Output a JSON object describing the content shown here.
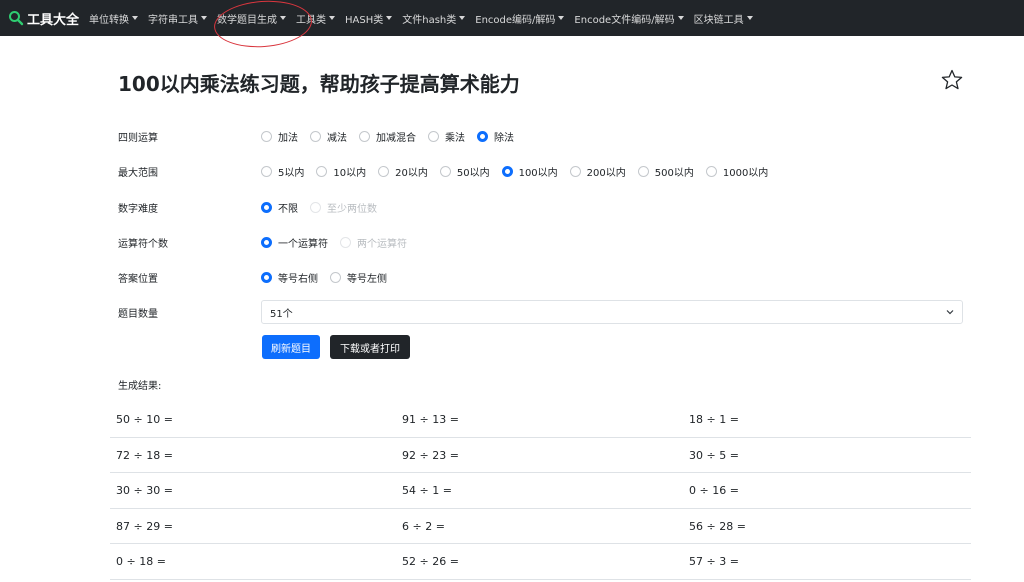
{
  "nav": {
    "brand": "工具大全",
    "items": [
      {
        "label": "单位转换"
      },
      {
        "label": "字符串工具"
      },
      {
        "label": "数学题目生成"
      },
      {
        "label": "工具类"
      },
      {
        "label": "HASH类"
      },
      {
        "label": "文件hash类"
      },
      {
        "label": "Encode编码/解码"
      },
      {
        "label": "Encode文件编码/解码"
      },
      {
        "label": "区块链工具"
      }
    ]
  },
  "page": {
    "title": "100以内乘法练习题，帮助孩子提高算术能力"
  },
  "form": {
    "operation": {
      "label": "四则运算",
      "options": [
        "加法",
        "减法",
        "加减混合",
        "乘法",
        "除法"
      ],
      "selected": "除法"
    },
    "range": {
      "label": "最大范围",
      "options": [
        "5以内",
        "10以内",
        "20以内",
        "50以内",
        "100以内",
        "200以内",
        "500以内",
        "1000以内"
      ],
      "selected": "100以内"
    },
    "difficulty": {
      "label": "数字难度",
      "options": [
        "不限",
        "至少两位数"
      ],
      "selected": "不限"
    },
    "operators": {
      "label": "运算符个数",
      "options": [
        "一个运算符",
        "两个运算符"
      ],
      "selected": "一个运算符"
    },
    "answer_position": {
      "label": "答案位置",
      "options": [
        "等号右侧",
        "等号左侧"
      ],
      "selected": "等号右侧"
    },
    "count": {
      "label": "题目数量",
      "value": "51个"
    },
    "refresh_label": "刷新题目",
    "print_label": "下载或者打印"
  },
  "results": {
    "label": "生成结果:",
    "rows": [
      [
        "50 ÷ 10 =",
        "91 ÷ 13 =",
        "18 ÷ 1 ="
      ],
      [
        "72 ÷ 18 =",
        "92 ÷ 23 =",
        "30 ÷ 5 ="
      ],
      [
        "30 ÷ 30 =",
        "54 ÷ 1 =",
        "0 ÷ 16 ="
      ],
      [
        "87 ÷ 29 =",
        "6 ÷ 2 =",
        "56 ÷ 28 ="
      ],
      [
        "0 ÷ 18 =",
        "52 ÷ 26 =",
        "57 ÷ 3 ="
      ]
    ]
  },
  "colors": {
    "navbar": "#212529",
    "primary": "#0d6efd",
    "annotation": "#d9363e"
  },
  "icons": {
    "brand": "magnifier-logo-icon",
    "favorite": "star-outline-icon",
    "select": "chevron-down-icon"
  }
}
